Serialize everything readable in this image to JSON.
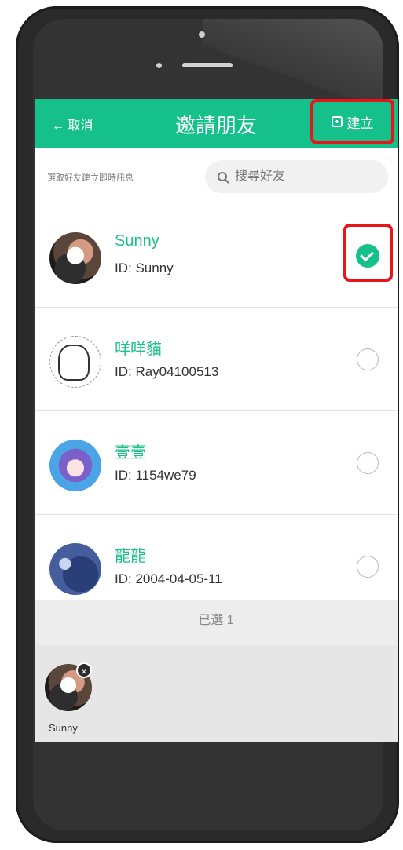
{
  "nav": {
    "back_label": "← 取消",
    "title": "邀請朋友",
    "create_label": "建立"
  },
  "search": {
    "hint": "選取好友建立即時訊息",
    "placeholder": "搜尋好友"
  },
  "friends": [
    {
      "name": "Sunny",
      "id": "ID: Sunny",
      "checked": true
    },
    {
      "name": "咩咩貓",
      "id": "ID: Ray04100513",
      "checked": false
    },
    {
      "name": "壹壹",
      "id": "ID: 1154we79",
      "checked": false
    },
    {
      "name": "龍龍",
      "id": "ID: 2004-04-05-11",
      "checked": false
    }
  ],
  "selected": {
    "count_label": "已選 1",
    "items": [
      {
        "name": "Sunny",
        "remove_icon": "×"
      }
    ]
  },
  "colors": {
    "accent": "#16c08a",
    "highlight": "#e8141a"
  }
}
